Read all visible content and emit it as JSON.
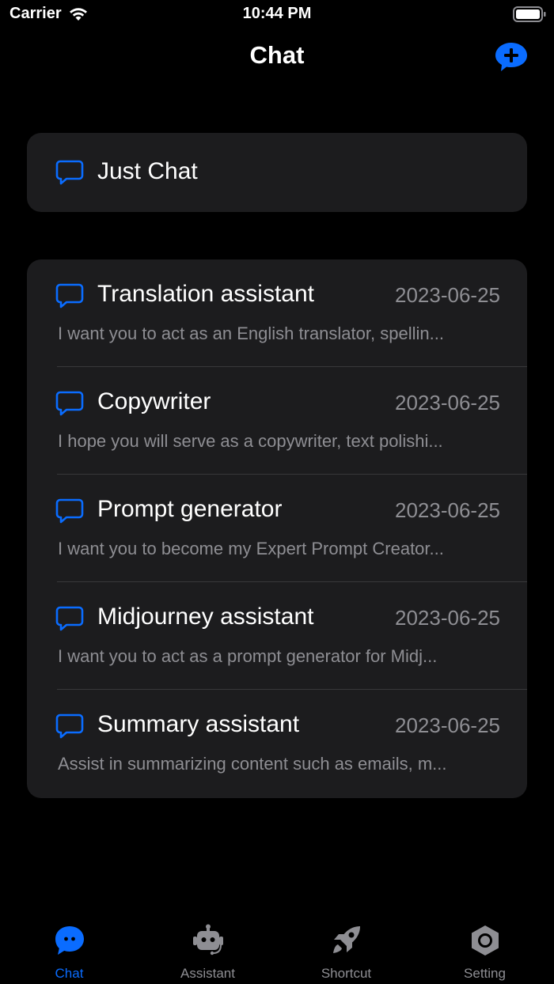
{
  "status_bar": {
    "carrier": "Carrier",
    "time": "10:44 PM"
  },
  "nav": {
    "title": "Chat"
  },
  "just_chat": {
    "label": "Just Chat"
  },
  "chats": [
    {
      "title": "Translation assistant",
      "date": "2023-06-25",
      "preview": "I want you to act as an English translator, spellin..."
    },
    {
      "title": "Copywriter",
      "date": "2023-06-25",
      "preview": "I hope you will serve as a copywriter, text polishi..."
    },
    {
      "title": "Prompt generator",
      "date": "2023-06-25",
      "preview": "I want you to become my Expert Prompt Creator..."
    },
    {
      "title": "Midjourney assistant",
      "date": "2023-06-25",
      "preview": "I want you to act as a prompt generator for Midj..."
    },
    {
      "title": "Summary assistant",
      "date": "2023-06-25",
      "preview": "Assist in summarizing content such as emails, m..."
    }
  ],
  "tabs": [
    {
      "label": "Chat",
      "icon": "chat-bubble-icon",
      "active": true
    },
    {
      "label": "Assistant",
      "icon": "robot-icon",
      "active": false
    },
    {
      "label": "Shortcut",
      "icon": "rocket-icon",
      "active": false
    },
    {
      "label": "Setting",
      "icon": "gear-hexagon-icon",
      "active": false
    }
  ],
  "colors": {
    "accent": "#0a6cff",
    "card": "#1c1c1e",
    "secondary_text": "#8e8e93",
    "background": "#000000"
  }
}
